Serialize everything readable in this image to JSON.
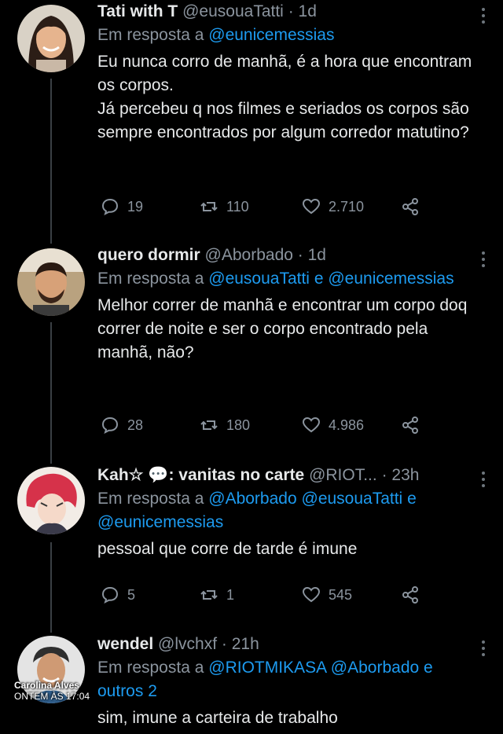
{
  "colors": {
    "background": "#000000",
    "text": "#e7e9ea",
    "muted": "#8b949e",
    "link": "#1d9bf0"
  },
  "tweets": [
    {
      "display_name": "Tati with T",
      "handle": "@eusouaTatti",
      "time": "1d",
      "reply_prefix": "Em resposta a",
      "reply_mentions": [
        "@eunicemessias"
      ],
      "text_lines": [
        "Eu nunca corro de manhã, é a hora que encontram os corpos.",
        "Já percebeu q nos filmes e seriados os corpos são sempre encontrados por algum corredor matutino?"
      ],
      "reply_count": "19",
      "retweet_count": "110",
      "like_count": "2.710"
    },
    {
      "display_name": "quero dormir",
      "handle": "@Aborbado",
      "time": "1d",
      "reply_prefix": "Em resposta a",
      "reply_mentions": [
        "@eusouaTatti",
        "e",
        "@eunicemessias"
      ],
      "text_lines": [
        "Melhor correr de manhã e encontrar um corpo doq correr de noite e ser o corpo encontrado pela manhã, não?"
      ],
      "reply_count": "28",
      "retweet_count": "180",
      "like_count": "4.986"
    },
    {
      "display_name": "Kah☆ 💬: vanitas no carte",
      "handle": "@RIOT...",
      "time": "23h",
      "reply_prefix": "Em resposta a",
      "reply_mentions": [
        "@Aborbado",
        "@eusouaTatti",
        "e",
        "@eunicemessias"
      ],
      "text_lines": [
        "pessoal que corre de tarde é imune"
      ],
      "reply_count": "5",
      "retweet_count": "1",
      "like_count": "545"
    },
    {
      "display_name": "wendel",
      "handle": "@lvchxf",
      "time": "21h",
      "reply_prefix": "Em resposta a",
      "reply_mentions": [
        "@RIOTMIKASA",
        "@Aborbado",
        "e",
        "outros 2"
      ],
      "text_lines": [
        "sim, imune a carteira de trabalho"
      ]
    }
  ],
  "separator": "·",
  "watermark": {
    "name": "Carolina Alves",
    "time": "ONTEM ÀS 17:04"
  }
}
